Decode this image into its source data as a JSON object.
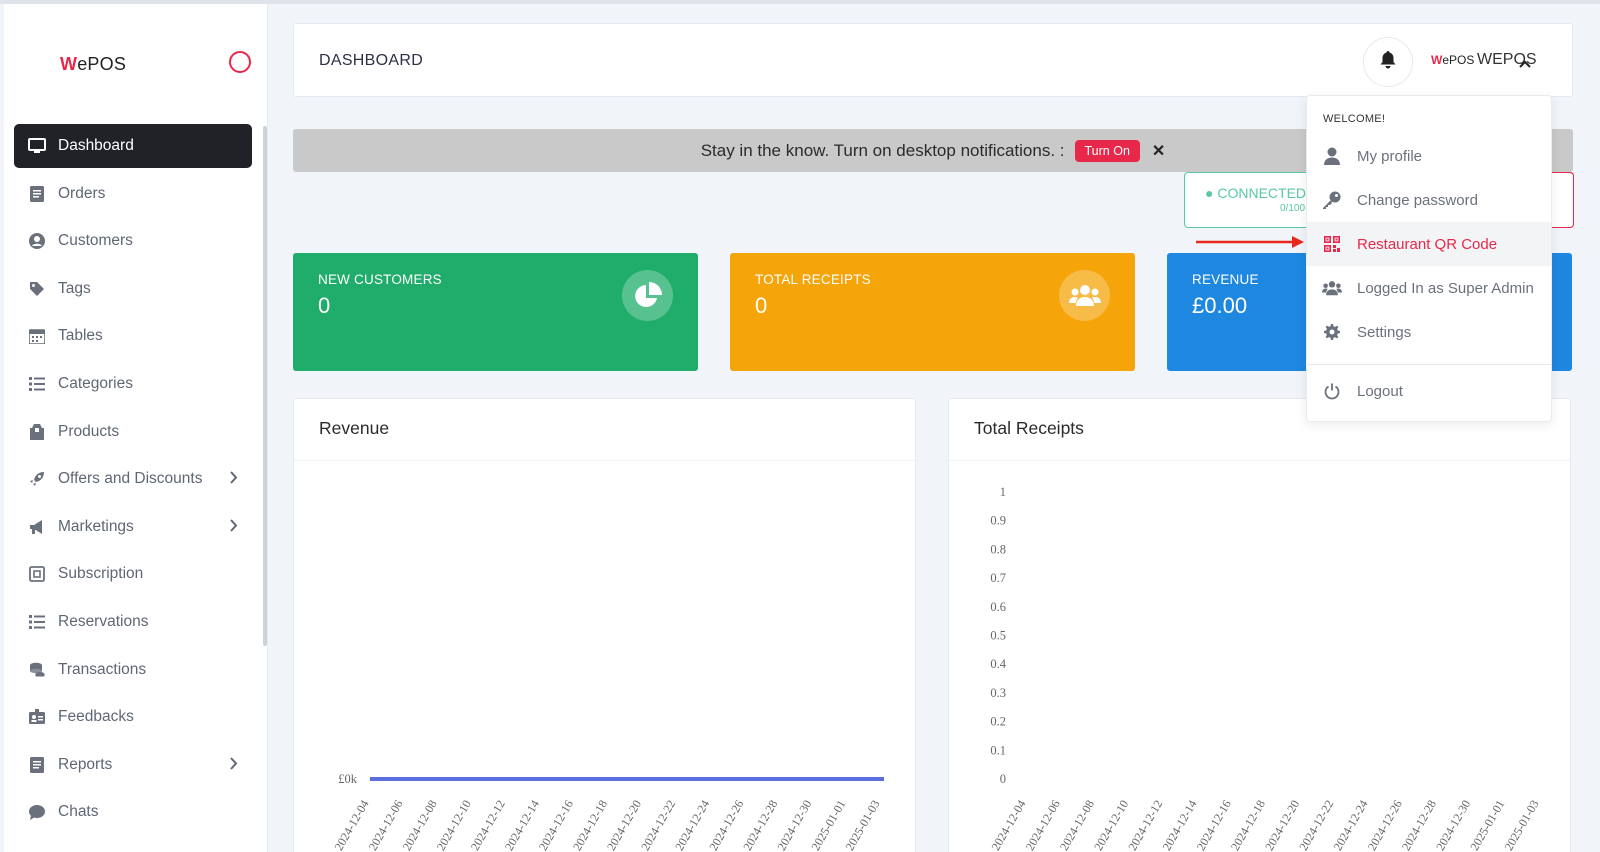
{
  "app": {
    "logo_w": "W",
    "logo_rest": "ePOS"
  },
  "sidebar": {
    "items": [
      {
        "label": "Dashboard",
        "icon": "monitor-icon"
      },
      {
        "label": "Orders",
        "icon": "orders-icon"
      },
      {
        "label": "Customers",
        "icon": "user-circle-icon"
      },
      {
        "label": "Tags",
        "icon": "tag-icon"
      },
      {
        "label": "Tables",
        "icon": "calendar-icon"
      },
      {
        "label": "Categories",
        "icon": "list-icon"
      },
      {
        "label": "Products",
        "icon": "box-icon"
      },
      {
        "label": "Offers and Discounts",
        "icon": "rocket-icon"
      },
      {
        "label": "Marketings",
        "icon": "megaphone-icon"
      },
      {
        "label": "Subscription",
        "icon": "subscription-icon"
      },
      {
        "label": "Reservations",
        "icon": "list-icon"
      },
      {
        "label": "Transactions",
        "icon": "coins-icon"
      },
      {
        "label": "Feedbacks",
        "icon": "id-card-icon"
      },
      {
        "label": "Reports",
        "icon": "report-icon"
      },
      {
        "label": "Chats",
        "icon": "chat-icon"
      }
    ]
  },
  "header": {
    "title": "DASHBOARD",
    "user_logo_w": "W",
    "user_logo_rest": "ePOS",
    "user_name": "WEPOS"
  },
  "notification": {
    "text": "Stay in the know. Turn on desktop notifications. :",
    "button": "Turn On",
    "close": "✕"
  },
  "connected": {
    "label": "CONNECTED",
    "sub": "0/100"
  },
  "cards": [
    {
      "title": "NEW CUSTOMERS",
      "value": "0",
      "color": "#20ad6b"
    },
    {
      "title": "TOTAL RECEIPTS",
      "value": "0",
      "color": "#f5a40a"
    },
    {
      "title": "REVENUE",
      "value": "£0.00",
      "color": "#1e87e0"
    }
  ],
  "dropdown": {
    "welcome": "WELCOME!",
    "items": [
      {
        "label": "My profile",
        "icon": "user-icon"
      },
      {
        "label": "Change password",
        "icon": "key-icon"
      },
      {
        "label": "Restaurant QR Code",
        "icon": "qr-code-icon"
      },
      {
        "label": "Logged In as Super Admin",
        "icon": "users-icon"
      },
      {
        "label": "Settings",
        "icon": "gear-icon"
      },
      {
        "label": "Logout",
        "icon": "power-icon"
      }
    ]
  },
  "chart_data": [
    {
      "type": "line",
      "title": "Revenue",
      "x": [
        "2024-12-04",
        "2024-12-06",
        "2024-12-08",
        "2024-12-10",
        "2024-12-12",
        "2024-12-14",
        "2024-12-16",
        "2024-12-18",
        "2024-12-20",
        "2024-12-22",
        "2024-12-24",
        "2024-12-26",
        "2024-12-28",
        "2024-12-30",
        "2025-01-01",
        "2025-01-03"
      ],
      "series": [
        {
          "values": [
            0,
            0,
            0,
            0,
            0,
            0,
            0,
            0,
            0,
            0,
            0,
            0,
            0,
            0,
            0,
            0
          ],
          "color": "#5b6ee1"
        }
      ],
      "yticks": [
        "£0k"
      ]
    },
    {
      "type": "line",
      "title": "Total Receipts",
      "x": [
        "2024-12-04",
        "2024-12-06",
        "2024-12-08",
        "2024-12-10",
        "2024-12-12",
        "2024-12-14",
        "2024-12-16",
        "2024-12-18",
        "2024-12-20",
        "2024-12-22",
        "2024-12-24",
        "2024-12-26",
        "2024-12-28",
        "2024-12-30",
        "2025-01-01",
        "2025-01-03"
      ],
      "yticks": [
        "1",
        "0.9",
        "0.8",
        "0.7",
        "0.6",
        "0.5",
        "0.4",
        "0.3",
        "0.2",
        "0.1",
        "0"
      ],
      "ylim": [
        0,
        1
      ]
    }
  ]
}
